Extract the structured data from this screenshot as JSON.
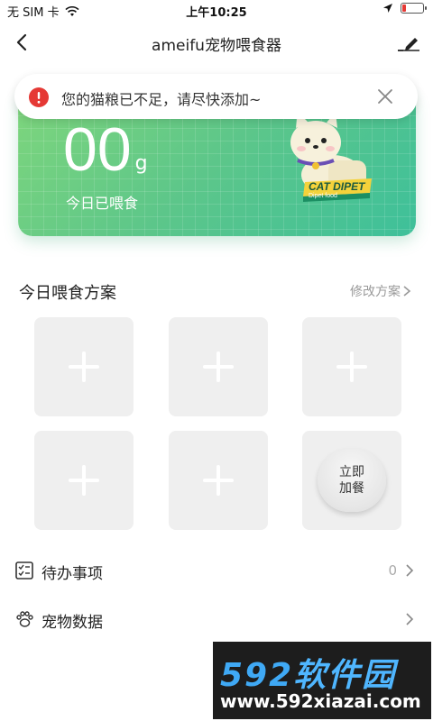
{
  "status_bar": {
    "carrier": "无 SIM 卡",
    "time": "上午10:25"
  },
  "nav": {
    "title": "ameifu宠物喂食器"
  },
  "alert": {
    "message": "您的猫粮已不足，请尽快添加~"
  },
  "hero": {
    "amount": "00",
    "unit": "g",
    "caption": "今日已喂食",
    "mascot_sign": "CAT DIPET",
    "mascot_subsign": "Dipet food"
  },
  "plan": {
    "title": "今日喂食方案",
    "modify_label": "修改方案",
    "add_meal_label": "立即加餐"
  },
  "rows": {
    "todo": {
      "label": "待办事项",
      "count": "0"
    },
    "pet_data": {
      "label": "宠物数据"
    }
  },
  "watermark": {
    "brand_num": "592",
    "brand_cn": "软件园",
    "url": "www.592xiazai.com"
  },
  "colors": {
    "hero_start": "#7fd67c",
    "hero_end": "#3ec09a",
    "alert_icon": "#e53935"
  }
}
